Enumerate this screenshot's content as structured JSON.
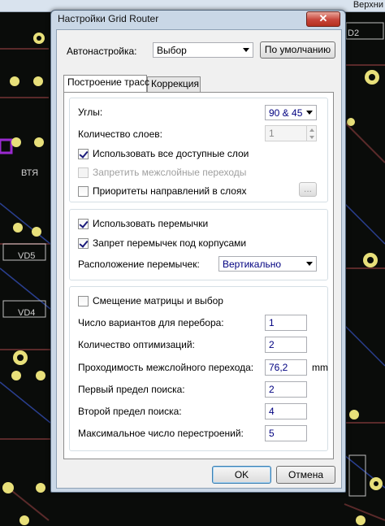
{
  "background": {
    "top_right_text": "Верхни"
  },
  "dialog": {
    "title": "Настройки Grid Router",
    "close_label": "✕",
    "autosetup": {
      "label": "Автонастройка:",
      "value": "Выбор",
      "default_button": "По умолчанию"
    },
    "tabs": [
      {
        "label": "Построение трасс",
        "active": true
      },
      {
        "label": "Коррекция",
        "active": false
      }
    ],
    "group1": {
      "angles_label": "Углы:",
      "angles_value": "90 & 45",
      "layers_label": "Количество слоев:",
      "layers_value": "1",
      "use_all_layers": {
        "label": "Использовать все доступные слои",
        "checked": true
      },
      "forbid_vias": {
        "label": "Запретить межслойные переходы",
        "checked": false,
        "disabled": true
      },
      "layer_priorities": {
        "label": "Приоритеты направлений в слоях",
        "checked": false
      },
      "ellipsis_button": "..."
    },
    "group2": {
      "use_jumpers": {
        "label": "Использовать перемычки",
        "checked": true
      },
      "forbid_jumpers_under": {
        "label": "Запрет перемычек под корпусами",
        "checked": true
      },
      "jumper_placement_label": "Расположение перемычек:",
      "jumper_placement_value": "Вертикально"
    },
    "group3": {
      "matrix_offset": {
        "label": "Смещение матрицы и выбор",
        "checked": false
      },
      "fields": [
        {
          "label": "Число вариантов для перебора:",
          "value": "1"
        },
        {
          "label": "Количество оптимизаций:",
          "value": "2"
        },
        {
          "label": "Проходимость межслойного перехода:",
          "value": "76,2",
          "unit": "mm"
        },
        {
          "label": "Первый предел поиска:",
          "value": "2"
        },
        {
          "label": "Второй предел поиска:",
          "value": "4"
        },
        {
          "label": "Максимальное число перестроений:",
          "value": "5"
        }
      ]
    },
    "ok_button": "OK",
    "cancel_button": "Отмена"
  }
}
